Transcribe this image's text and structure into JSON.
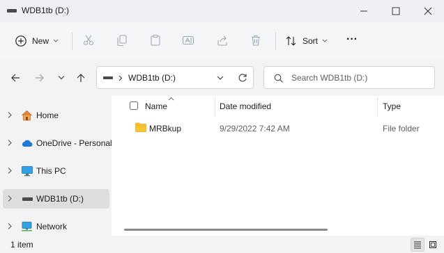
{
  "window": {
    "title": "WDB1tb (D:)",
    "controls": [
      "minimize",
      "maximize",
      "close"
    ]
  },
  "toolbar": {
    "new_label": "New",
    "sort_label": "Sort",
    "more_label": "···",
    "icons": [
      "cut-icon",
      "copy-icon",
      "paste-icon",
      "rename-icon",
      "share-icon",
      "delete-icon"
    ]
  },
  "address_bar": {
    "path": "WDB1tb (D:)"
  },
  "search": {
    "placeholder": "Search WDB1tb (D:)"
  },
  "sidebar": {
    "items": [
      {
        "label": "Home",
        "icon": "home-icon",
        "selected": false
      },
      {
        "label": "OneDrive - Personal",
        "icon": "cloud-icon",
        "selected": false
      },
      {
        "label": "This PC",
        "icon": "monitor-icon",
        "selected": false
      },
      {
        "label": "WDB1tb (D:)",
        "icon": "drive-icon",
        "selected": true
      },
      {
        "label": "Network",
        "icon": "network-icon",
        "selected": false
      }
    ]
  },
  "file_list": {
    "columns": [
      "Name",
      "Date modified",
      "Type"
    ],
    "rows": [
      {
        "name": "MRBkup",
        "date_modified": "9/29/2022 7:42 AM",
        "type": "File folder",
        "icon": "folder-icon"
      }
    ]
  },
  "status": {
    "item_count": "1 item"
  },
  "colors": {
    "accent": "#0067c0",
    "folder": "#f8c433",
    "selection": "#dddddd"
  }
}
